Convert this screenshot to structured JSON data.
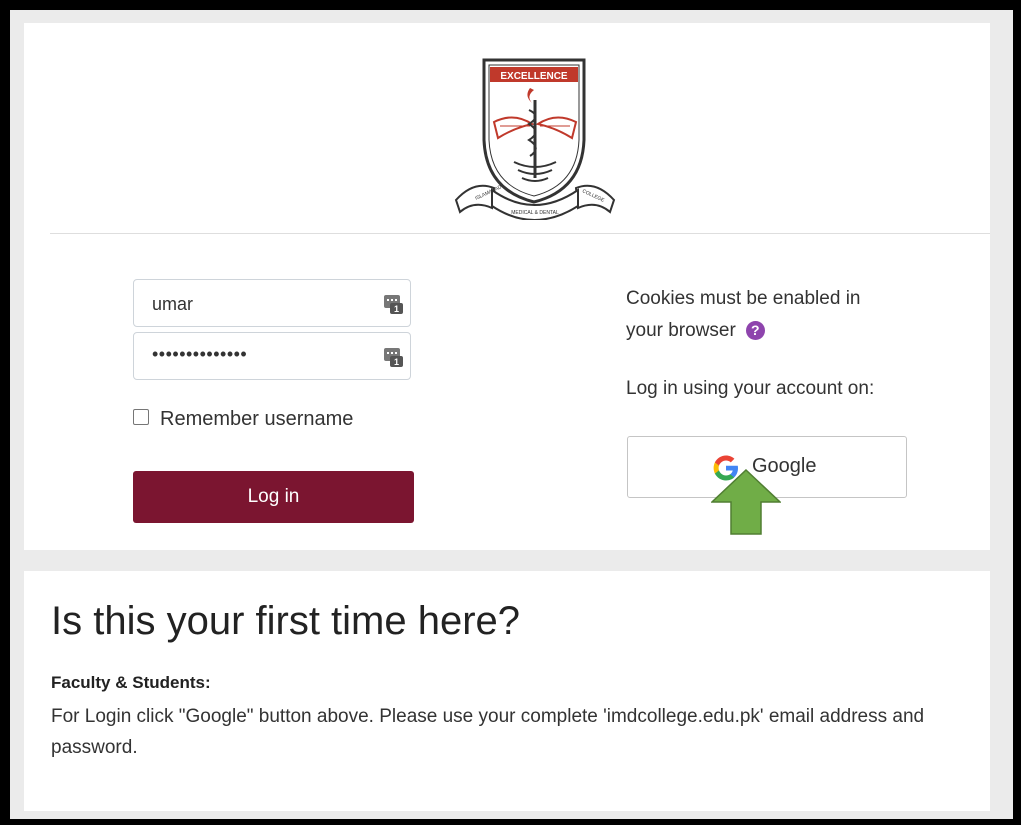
{
  "logo": {
    "motto": "EXCELLENCE",
    "ribbon_left": "ISLAMABAD",
    "ribbon_center": "MEDICAL & DENTAL",
    "ribbon_right": "COLLEGE"
  },
  "login": {
    "username_value": "umar",
    "password_value": "••••••••••••••",
    "remember_label": "Remember username",
    "login_button": "Log in"
  },
  "sidebar": {
    "cookies_line1": "Cookies must be enabled in",
    "cookies_line2": "your browser",
    "login_using": "Log in using your account on:",
    "google_button": "Google"
  },
  "signup": {
    "title": "Is this your first time here?",
    "subtitle": "Faculty & Students:",
    "text": "For Login click \"Google\" button above.  Please use your complete 'imdcollege.edu.pk' email address and password."
  },
  "colors": {
    "login_button": "#7b1530",
    "help_icon": "#8e44ad",
    "arrow": "#70ad47"
  },
  "icons": {
    "password_manager": "key-icon",
    "help": "question-circle-icon",
    "google": "google-g-icon",
    "pointer": "green-up-arrow-icon"
  }
}
